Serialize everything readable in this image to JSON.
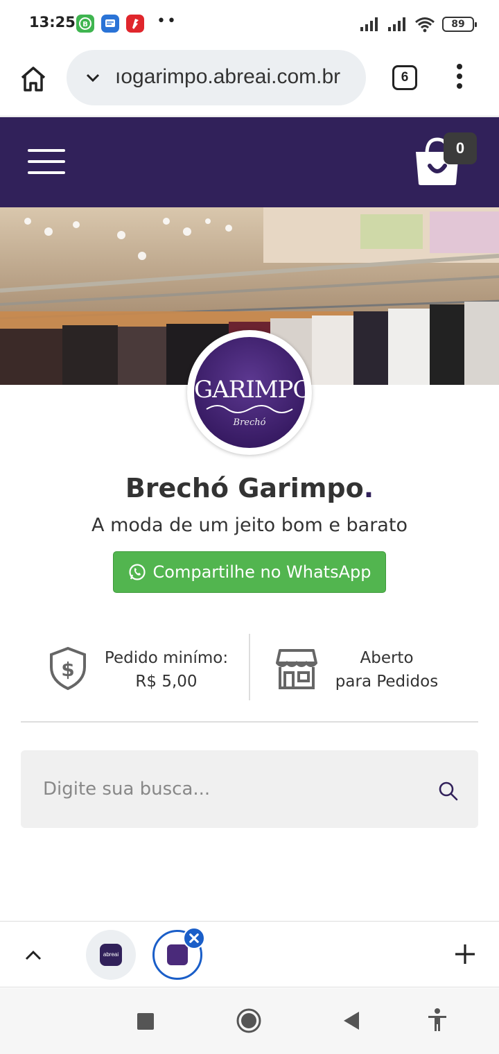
{
  "status_bar": {
    "time": "13:25",
    "notification_dots": "••",
    "battery": "89",
    "icons": [
      "whatsapp-business-icon",
      "messages-icon",
      "app-notification-icon",
      "signal-icon",
      "signal-icon",
      "wifi-icon",
      "battery-icon"
    ]
  },
  "browser": {
    "url": "ıogarimpo.abreai.com.br",
    "tab_count": "6"
  },
  "header": {
    "cart_count": "0",
    "brand_color": "#31215a"
  },
  "store": {
    "logo_text": "GARIMPO",
    "logo_subtext": "Brechó",
    "name": "Brechó Garimpo",
    "name_dot": ".",
    "tagline": "A moda de um jeito bom e barato",
    "share_button": "Compartilhe no WhatsApp",
    "share_color": "#52b54f"
  },
  "info": {
    "min_order_label": "Pedido minímo:",
    "min_order_value": "R$ 5,00",
    "open_status_line1": "Aberto",
    "open_status_line2": "para Pedidos"
  },
  "search": {
    "placeholder": "Digite sua busca..."
  },
  "tab_strip": {
    "tab1_label": "abreai"
  }
}
